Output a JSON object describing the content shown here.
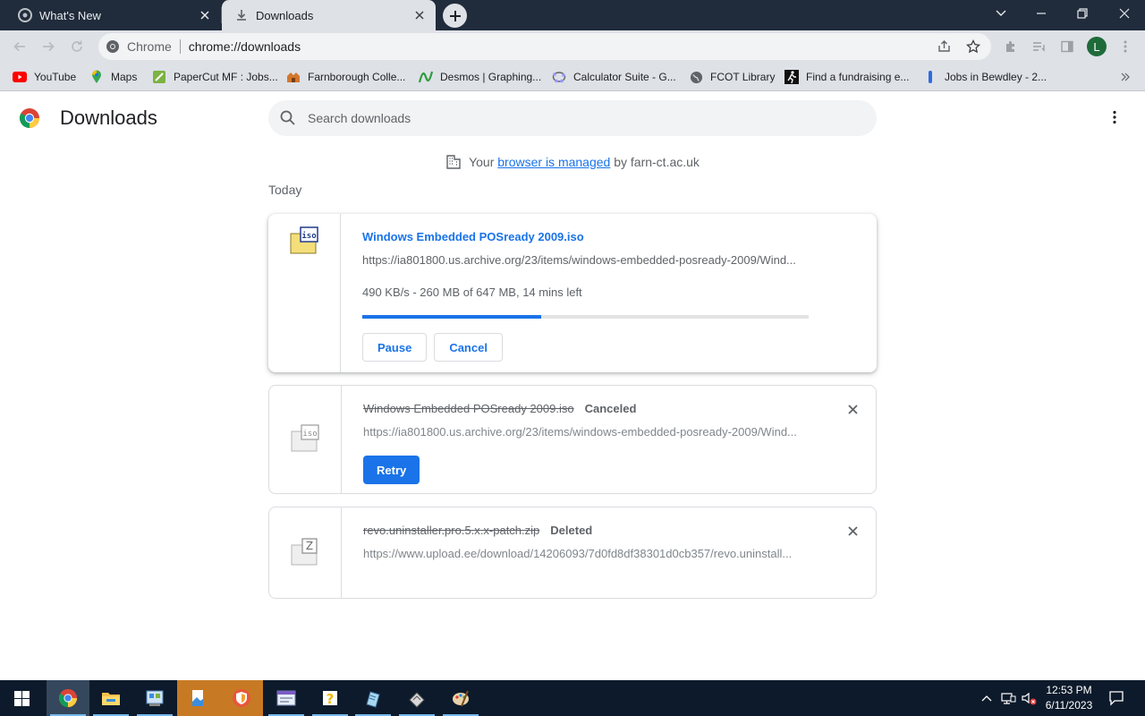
{
  "browser": {
    "tabs": [
      {
        "title": "What's New",
        "active": false
      },
      {
        "title": "Downloads",
        "active": true
      }
    ],
    "omnibox": {
      "site_name": "Chrome",
      "url": "chrome://downloads"
    },
    "profile_initial": "L",
    "bookmarks": [
      {
        "label": "YouTube",
        "icon": "youtube-icon"
      },
      {
        "label": "Maps",
        "icon": "maps-icon"
      },
      {
        "label": "PaperCut MF : Jobs...",
        "icon": "papercut-icon"
      },
      {
        "label": "Farnborough Colle...",
        "icon": "college-icon"
      },
      {
        "label": "Desmos | Graphing...",
        "icon": "desmos-icon"
      },
      {
        "label": "Calculator Suite - G...",
        "icon": "geogebra-icon"
      },
      {
        "label": "FCOT Library",
        "icon": "globe-icon"
      },
      {
        "label": "Find a fundraising e...",
        "icon": "runner-icon"
      },
      {
        "label": "Jobs in Bewdley - 2...",
        "icon": "jobs-icon"
      }
    ]
  },
  "page": {
    "title": "Downloads",
    "search_placeholder": "Search downloads",
    "managed": {
      "prefix": "Your",
      "link": "browser is managed",
      "suffix": "by farn-ct.ac.uk"
    },
    "section_label": "Today"
  },
  "downloads": [
    {
      "filename": "Windows Embedded POSready 2009.iso",
      "url": "https://ia801800.us.archive.org/23/items/windows-embedded-posready-2009/Wind...",
      "state": "in-progress",
      "progress_text": "490 KB/s - 260 MB of 647 MB, 14 mins left",
      "progress_fraction": 0.4,
      "buttons": {
        "pause": "Pause",
        "cancel": "Cancel"
      },
      "icon": "iso-file-icon"
    },
    {
      "filename": "Windows Embedded POSready 2009.iso",
      "status": "Canceled",
      "url": "https://ia801800.us.archive.org/23/items/windows-embedded-posready-2009/Wind...",
      "state": "canceled",
      "retry_label": "Retry",
      "icon": "iso-file-icon"
    },
    {
      "filename": "revo.uninstaller.pro.5.x.x-patch.zip",
      "status": "Deleted",
      "url": "https://www.upload.ee/download/14206093/7d0fd8df38301d0cb357/revo.uninstall...",
      "state": "deleted",
      "icon": "zip-file-icon"
    }
  ],
  "taskbar": {
    "time": "12:53 PM",
    "date": "6/11/2023"
  },
  "colors": {
    "accent": "#1a73e8",
    "tabstrip": "#202c3c",
    "toolbar": "#dee1e6",
    "taskbar": "#0d1a2b"
  }
}
